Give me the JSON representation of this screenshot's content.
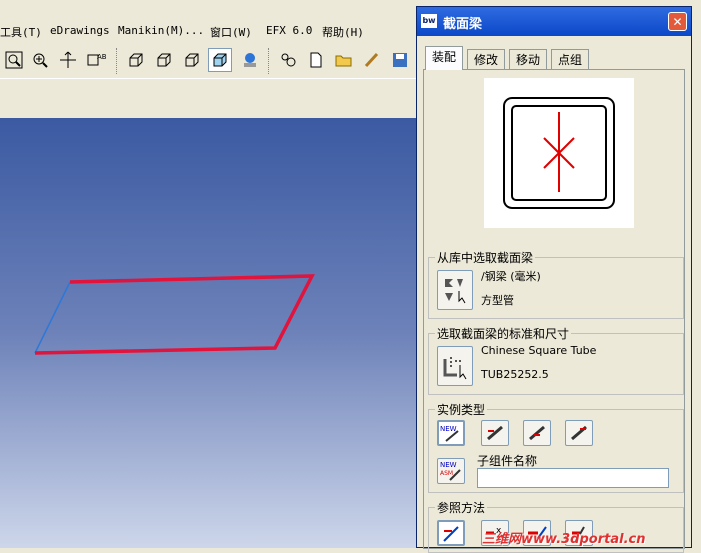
{
  "menubar": {
    "items": [
      "工具(T)",
      "eDrawings",
      "Manikin(M)...",
      "窗口(W)",
      "EFX 6.0",
      "帮助(H)"
    ]
  },
  "toolbar": {
    "icons": [
      "zoom-window-icon",
      "zoom-in-icon",
      "pan-icon",
      "rotate-icon",
      "box-view-icon",
      "box-view-2-icon",
      "box-view-3-icon",
      "shaded-view-icon",
      "sphere-icon",
      "sketch-icon",
      "new-document-icon",
      "open-folder-icon",
      "brush-icon",
      "save-icon"
    ]
  },
  "dialog": {
    "title": "截面梁",
    "icon_text": "bw",
    "close_symbol": "✕",
    "tabs": [
      "装配",
      "修改",
      "移动",
      "点组"
    ],
    "active_tab": "装配",
    "library_group": {
      "title": "从库中选取截面梁",
      "line1": "/钢梁 (毫米)",
      "line2": "方型管"
    },
    "standard_group": {
      "title": "选取截面梁的标准和尺寸",
      "line1": "Chinese Square Tube",
      "line2": "TUB25252.5"
    },
    "instance_group": {
      "title": "实例类型",
      "subassembly_label": "子组件名称",
      "subassembly_value": ""
    },
    "reference_group": {
      "title": "参照方法"
    }
  },
  "colors": {
    "viewport_top": "#3b5aa2",
    "viewport_bottom": "#cdd6ea",
    "beam_red": "#e0143c",
    "title_blue": "#0b48c8"
  },
  "watermark": "三维网www.3dportal.cn"
}
